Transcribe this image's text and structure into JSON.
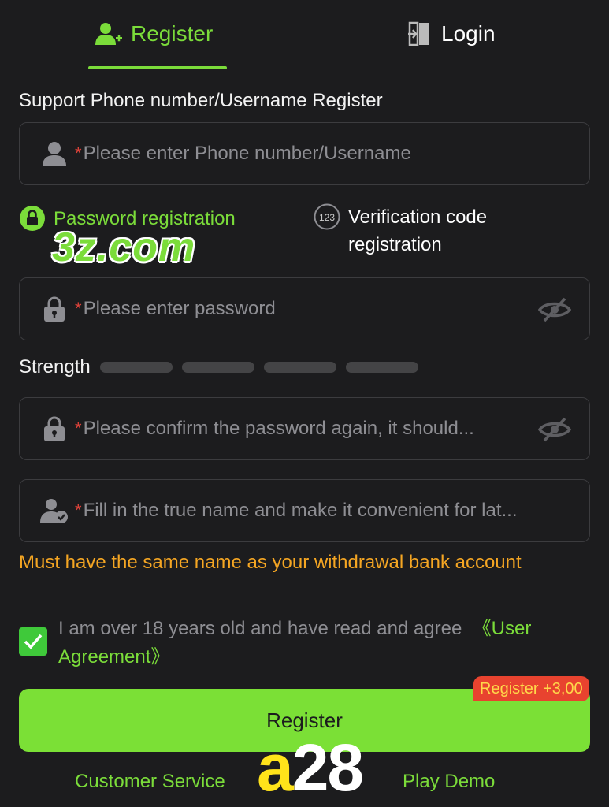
{
  "tabs": {
    "register": "Register",
    "login": "Login"
  },
  "form": {
    "section_label": "Support Phone number/Username Register",
    "required_mark": "*",
    "username_placeholder": "Please enter Phone number/Username",
    "mode_password": "Password registration",
    "mode_verification": "Verification code registration",
    "mode_verification_badge": "123",
    "password_placeholder": "Please enter password",
    "strength_label": "Strength",
    "strength_level": 0,
    "confirm_placeholder": "Please confirm the password again, it should...",
    "realname_placeholder": "Fill in the true name and make it convenient for lat...",
    "name_warning": "Must have the same name as your withdrawal bank account",
    "agree_text": "I am over 18 years old and have read and agree",
    "agree_link": "《User Agreement》",
    "agree_checked": true,
    "register_button": "Register",
    "register_bonus": "Register +3,00"
  },
  "watermarks": {
    "site": "3z.com",
    "a28_a": "a",
    "a28_rest": "28"
  },
  "footer": {
    "customer_service": "Customer Service",
    "play_demo": "Play Demo"
  },
  "colors": {
    "accent": "#7bdc3a",
    "warning": "#f5a623",
    "bonus_bg": "#e8432f",
    "background": "#1c1c1e"
  }
}
